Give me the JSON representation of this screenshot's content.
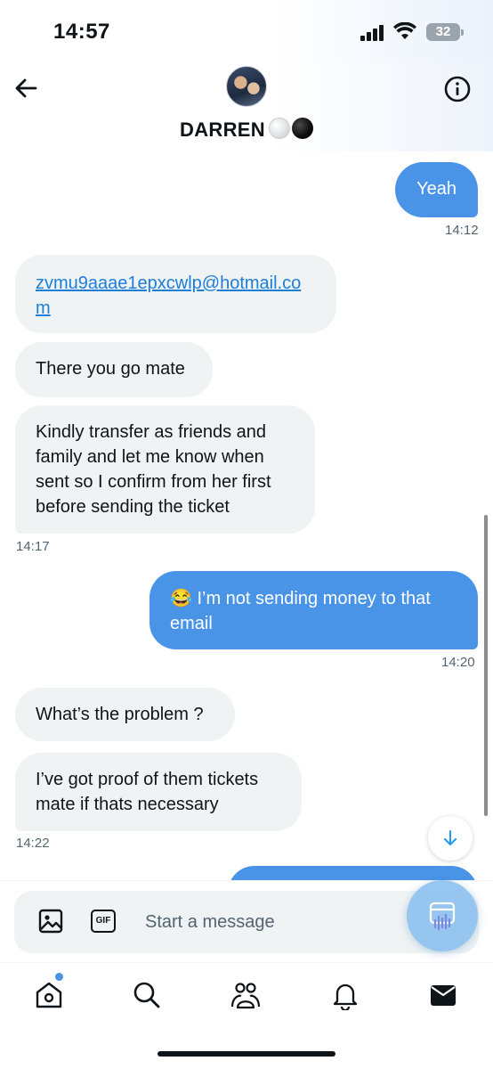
{
  "status_bar": {
    "time": "14:57",
    "battery": "32"
  },
  "header": {
    "contact_name": "DARREN",
    "name_emoji": "white-circle, black-circle"
  },
  "messages": [
    {
      "id": "m1",
      "direction": "out",
      "text": "Yeah",
      "timestamp": "14:12"
    },
    {
      "id": "m2",
      "direction": "in",
      "text": "zvmu9aaae1epxcwlp@hotmail.co",
      "text_line2": "m",
      "is_link": true
    },
    {
      "id": "m3",
      "direction": "in",
      "text": "There you go mate"
    },
    {
      "id": "m4",
      "direction": "in",
      "lines": [
        "Kindly transfer as friends and",
        "family and let me know when",
        "sent so I confirm from her first",
        "before sending the ticket"
      ],
      "timestamp": "14:17"
    },
    {
      "id": "m5",
      "direction": "out",
      "emoji": "😂",
      "lines": [
        "I’m not sending money to that",
        "email"
      ],
      "timestamp": "14:20"
    },
    {
      "id": "m6",
      "direction": "in",
      "text": "What’s the problem ?"
    },
    {
      "id": "m7",
      "direction": "in",
      "lines": [
        "I’ve got proof of them tickets",
        "mate if thats necessary"
      ],
      "timestamp": "14:22"
    }
  ],
  "composer": {
    "placeholder": "Start a message",
    "gif_label": "GIF"
  },
  "nav": {
    "items": [
      "home-icon",
      "search-icon",
      "communities-icon",
      "notifications-icon",
      "messages-icon"
    ]
  },
  "colors": {
    "outgoing_bubble": "#4a94e8",
    "incoming_bubble": "#eff3f4",
    "link": "#1d7ed8",
    "timestamp": "#536471"
  }
}
